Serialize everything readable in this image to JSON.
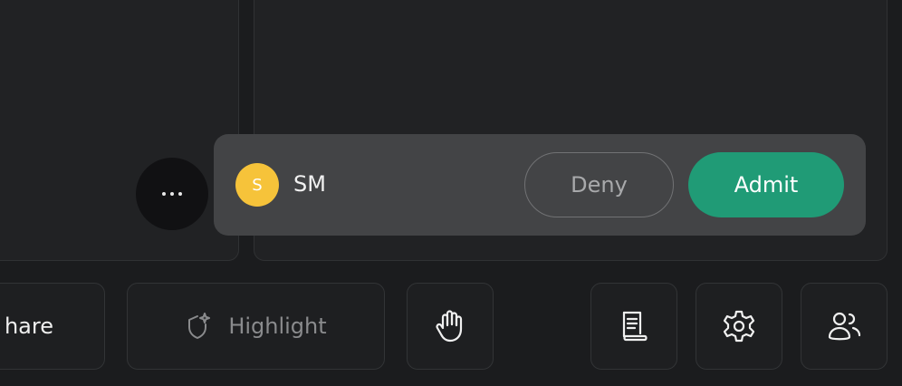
{
  "more": {
    "icon": "more-dots-icon"
  },
  "waiting_participant": {
    "initial": "S",
    "name": "SM",
    "avatar_color": "#f6c33a"
  },
  "actions": {
    "deny_label": "Deny",
    "admit_label": "Admit",
    "admit_color": "#209b76"
  },
  "toolbar": {
    "share_label": "hare",
    "highlight_label": "Highlight",
    "highlight_icon": "shield-sparkle-icon",
    "raise_hand_icon": "hand-icon",
    "notes_icon": "scroll-notes-icon",
    "settings_icon": "gear-icon",
    "participants_icon": "people-icon"
  }
}
